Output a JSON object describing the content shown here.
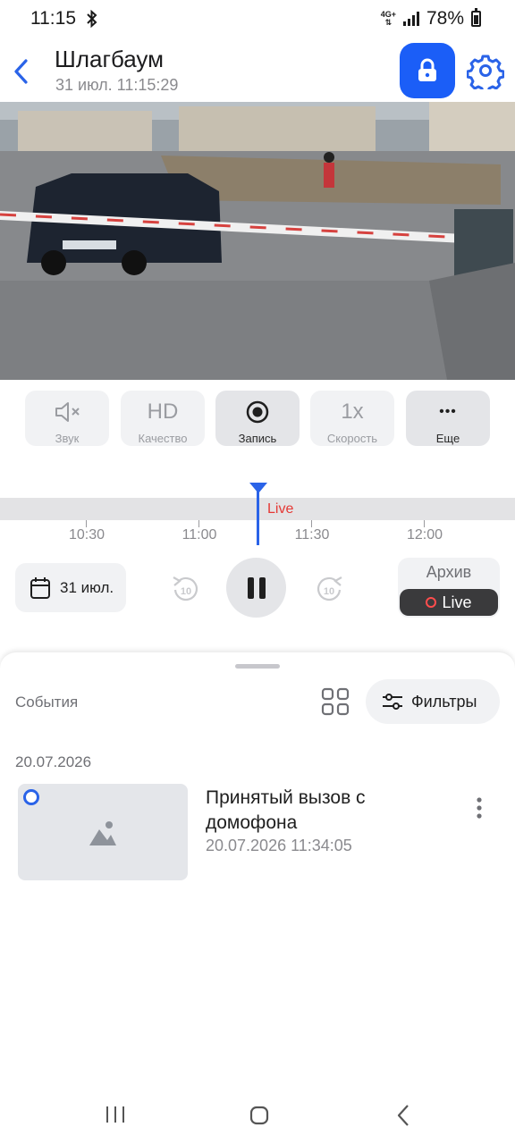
{
  "status_bar": {
    "time": "11:15",
    "network": "4G+",
    "battery": "78%"
  },
  "header": {
    "title": "Шлагбаум",
    "subtitle": "31 июл. 11:15:29",
    "icons": [
      "back-icon",
      "lock-icon",
      "gear-icon"
    ]
  },
  "controls": [
    {
      "icon": "sound-off-icon",
      "glyph": "",
      "label": "Звук"
    },
    {
      "icon": "hd-icon",
      "glyph": "HD",
      "label": "Качество"
    },
    {
      "icon": "record-icon",
      "glyph": "",
      "label": "Запись"
    },
    {
      "icon": "speed-icon",
      "glyph": "1x",
      "label": "Скорость"
    },
    {
      "icon": "more-icon",
      "glyph": "•••",
      "label": "Еще"
    }
  ],
  "timeline": {
    "live_label": "Live",
    "ticks": [
      "10:30",
      "11:00",
      "11:30",
      "12:00"
    ]
  },
  "transport": {
    "date_label": "31 июл.",
    "skip_back_icon": "replay-10-icon",
    "skip_forward_icon": "forward-10-icon",
    "archive_label": "Архив",
    "live_label": "Live"
  },
  "events": {
    "title": "События",
    "filters_label": "Фильтры",
    "date_group": "20.07.2026",
    "items": [
      {
        "title": "Принятый вызов с домофона",
        "time": "20.07.2026 11:34:05"
      }
    ]
  },
  "colors": {
    "accent": "#1b5ef7",
    "live_red": "#e53935",
    "cursor_blue": "#2a63e8"
  }
}
